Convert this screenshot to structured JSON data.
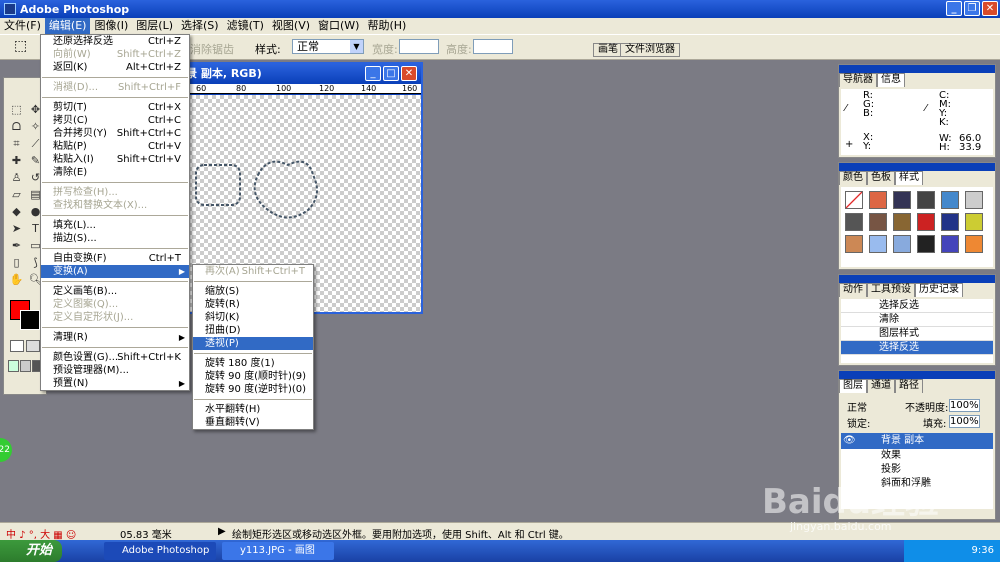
{
  "window": {
    "title": "Adobe Photoshop"
  },
  "menubar": [
    "文件(F)",
    "编辑(E)",
    "图像(I)",
    "图层(L)",
    "选择(S)",
    "滤镜(T)",
    "视图(V)",
    "窗口(W)",
    "帮助(H)"
  ],
  "options": {
    "feather": "消除锯齿",
    "style_label": "样式:",
    "style_value": "正常",
    "width_label": "宽度:",
    "height_label": "高度:",
    "well_tabs": [
      "画笔",
      "文件浏览器"
    ]
  },
  "document": {
    "title": "景 副本, RGB)",
    "ruler": [
      "60",
      "80",
      "100",
      "120",
      "140",
      "160"
    ]
  },
  "edit_menu": [
    {
      "label": "还原选择反选",
      "shortcut": "Ctrl+Z"
    },
    {
      "label": "向前(W)",
      "shortcut": "Shift+Ctrl+Z",
      "disabled": true
    },
    {
      "label": "返回(K)",
      "shortcut": "Alt+Ctrl+Z"
    },
    {
      "sep": true
    },
    {
      "label": "消褪(D)...",
      "shortcut": "Shift+Ctrl+F",
      "disabled": true
    },
    {
      "sep": true
    },
    {
      "label": "剪切(T)",
      "shortcut": "Ctrl+X"
    },
    {
      "label": "拷贝(C)",
      "shortcut": "Ctrl+C"
    },
    {
      "label": "合并拷贝(Y)",
      "shortcut": "Shift+Ctrl+C"
    },
    {
      "label": "粘贴(P)",
      "shortcut": "Ctrl+V"
    },
    {
      "label": "粘贴入(I)",
      "shortcut": "Shift+Ctrl+V"
    },
    {
      "label": "清除(E)",
      "shortcut": ""
    },
    {
      "sep": true
    },
    {
      "label": "拼写检查(H)...",
      "shortcut": "",
      "disabled": true
    },
    {
      "label": "查找和替换文本(X)...",
      "shortcut": "",
      "disabled": true
    },
    {
      "sep": true
    },
    {
      "label": "填充(L)...",
      "shortcut": ""
    },
    {
      "label": "描边(S)...",
      "shortcut": ""
    },
    {
      "sep": true
    },
    {
      "label": "自由变换(F)",
      "shortcut": "Ctrl+T"
    },
    {
      "label": "变换(A)",
      "shortcut": "",
      "highlight": true,
      "sub": true
    },
    {
      "sep": true
    },
    {
      "label": "定义画笔(B)...",
      "shortcut": ""
    },
    {
      "label": "定义图案(Q)...",
      "shortcut": "",
      "disabled": true
    },
    {
      "label": "定义自定形状(J)...",
      "shortcut": "",
      "disabled": true
    },
    {
      "sep": true
    },
    {
      "label": "清理(R)",
      "shortcut": "",
      "sub": true
    },
    {
      "sep": true
    },
    {
      "label": "颜色设置(G)...",
      "shortcut": "Shift+Ctrl+K"
    },
    {
      "label": "预设管理器(M)...",
      "shortcut": ""
    },
    {
      "label": "预置(N)",
      "shortcut": "",
      "sub": true
    }
  ],
  "transform_menu": [
    {
      "label": "再次(A)",
      "shortcut": "Shift+Ctrl+T",
      "disabled": true
    },
    {
      "sep": true
    },
    {
      "label": "缩放(S)",
      "shortcut": ""
    },
    {
      "label": "旋转(R)",
      "shortcut": ""
    },
    {
      "label": "斜切(K)",
      "shortcut": ""
    },
    {
      "label": "扭曲(D)",
      "shortcut": ""
    },
    {
      "label": "透视(P)",
      "shortcut": "",
      "highlight": true
    },
    {
      "sep": true
    },
    {
      "label": "旋转 180 度(1)",
      "shortcut": ""
    },
    {
      "label": "旋转 90 度(顺时针)(9)",
      "shortcut": ""
    },
    {
      "label": "旋转 90 度(逆时针)(0)",
      "shortcut": ""
    },
    {
      "sep": true
    },
    {
      "label": "水平翻转(H)",
      "shortcut": ""
    },
    {
      "label": "垂直翻转(V)",
      "shortcut": ""
    }
  ],
  "info_panel": {
    "tabs": [
      "导航器",
      "信息"
    ],
    "rgb": "R:\nG:\nB:",
    "cmyk": "C:\nM:\nY:\nK:",
    "xy": "X:\nY:",
    "w_label": "W:",
    "w_value": "66.0",
    "h_label": "H:",
    "h_value": "33.9"
  },
  "styles_panel": {
    "tabs": [
      "颜色",
      "色板",
      "样式"
    ]
  },
  "history_panel": {
    "tabs": [
      "动作",
      "工具预设",
      "历史记录"
    ],
    "items": [
      "选择反选",
      "清除",
      "图层样式",
      "选择反选"
    ]
  },
  "layers_panel": {
    "tabs": [
      "图层",
      "通道",
      "路径"
    ],
    "blend": "正常",
    "opacity_label": "不透明度:",
    "opacity": "100%",
    "lock_label": "锁定:",
    "fill_label": "填充:",
    "fill": "100%",
    "layer_name": "背景 副本",
    "effects": [
      "效果",
      "投影",
      "斜面和浮雕"
    ]
  },
  "status": {
    "zoom": "05.83 毫米",
    "hint": "绘制矩形选区或移动选区外框。要用附加选项，使用 Shift、Alt 和 Ctrl 键。"
  },
  "taskbar": {
    "start": "开始",
    "tasks": [
      "Adobe Photoshop",
      "y113.JPG - 画图"
    ],
    "time": "9:36"
  },
  "watermark": "Baidu经验",
  "watermark_url": "jingyan.baidu.com"
}
